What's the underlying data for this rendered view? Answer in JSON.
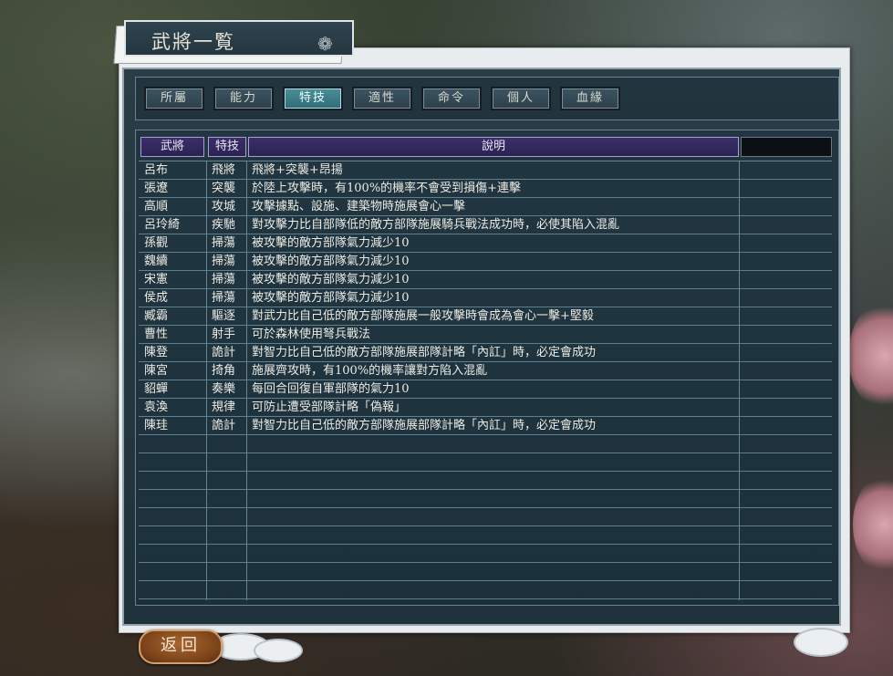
{
  "window": {
    "title": "武將一覧"
  },
  "tabs": [
    "所屬",
    "能力",
    "特技",
    "適性",
    "命令",
    "個人",
    "血緣"
  ],
  "active_tab": "特技",
  "table": {
    "headers": [
      "武將",
      "特技",
      "說明"
    ],
    "rows": [
      [
        "呂布",
        "飛將",
        "飛將+突襲+昂揚"
      ],
      [
        "張遼",
        "突襲",
        "於陸上攻擊時，有100%的機率不會受到損傷+連擊"
      ],
      [
        "高順",
        "攻城",
        "攻擊據點、設施、建築物時施展會心一擊"
      ],
      [
        "呂玲綺",
        "疾馳",
        "對攻擊力比自部隊低的敵方部隊施展騎兵戰法成功時，必使其陷入混亂"
      ],
      [
        "孫觀",
        "掃蕩",
        "被攻擊的敵方部隊氣力減少10"
      ],
      [
        "魏續",
        "掃蕩",
        "被攻擊的敵方部隊氣力減少10"
      ],
      [
        "宋憲",
        "掃蕩",
        "被攻擊的敵方部隊氣力減少10"
      ],
      [
        "侯成",
        "掃蕩",
        "被攻擊的敵方部隊氣力減少10"
      ],
      [
        "臧霸",
        "驅逐",
        "對武力比自己低的敵方部隊施展一般攻擊時會成為會心一擊+堅毅"
      ],
      [
        "曹性",
        "射手",
        "可於森林使用弩兵戰法"
      ],
      [
        "陳登",
        "詭計",
        "對智力比自己低的敵方部隊施展部隊計略「內訌」時，必定會成功"
      ],
      [
        "陳宮",
        "掎角",
        "施展齊攻時，有100%的機率讓對方陷入混亂"
      ],
      [
        "貂蟬",
        "奏樂",
        "每回合回復自軍部隊的氣力10"
      ],
      [
        "袁渙",
        "規律",
        "可防止遭受部隊計略「偽報」"
      ],
      [
        "陳珪",
        "詭計",
        "對智力比自己低的敵方部隊施展部隊計略「內訌」時，必定會成功"
      ],
      [
        "",
        "",
        ""
      ],
      [
        "",
        "",
        ""
      ],
      [
        "",
        "",
        ""
      ],
      [
        "",
        "",
        ""
      ],
      [
        "",
        "",
        ""
      ],
      [
        "",
        "",
        ""
      ],
      [
        "",
        "",
        ""
      ],
      [
        "",
        "",
        ""
      ],
      [
        "",
        "",
        ""
      ]
    ]
  },
  "footer": {
    "return_label": "返回"
  },
  "colors": {
    "panel": "#243640",
    "header": "#2a2352",
    "active_tab": "#2f6b77",
    "return_button": "#7a4219"
  }
}
